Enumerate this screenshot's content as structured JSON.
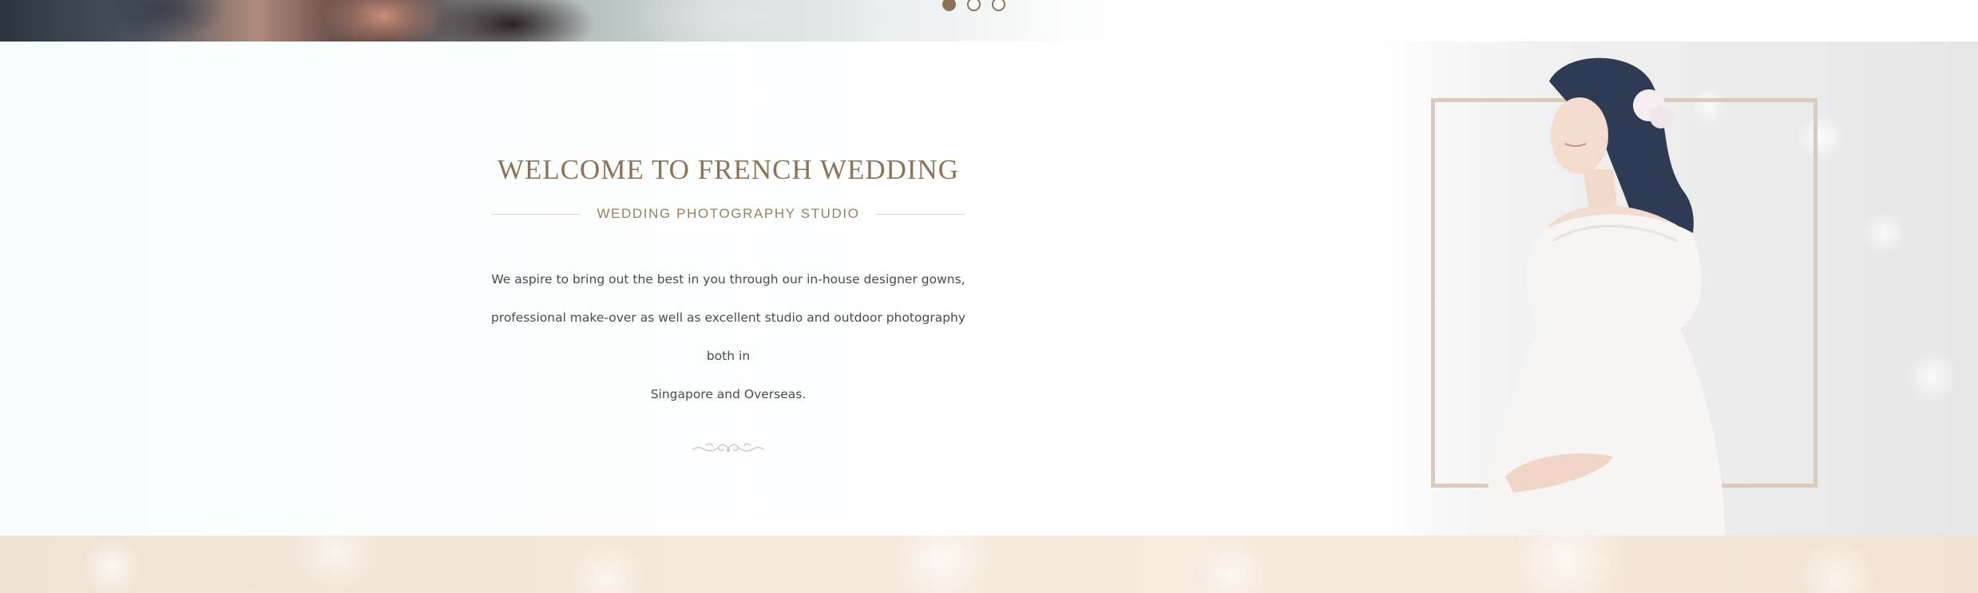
{
  "hero_slider": {
    "slides": [
      {
        "label": "slide-1",
        "active": true
      },
      {
        "label": "slide-2",
        "active": false
      },
      {
        "label": "slide-3",
        "active": false
      }
    ]
  },
  "welcome": {
    "title": "WELCOME TO FRENCH WEDDING",
    "subtitle": "WEDDING PHOTOGRAPHY STUDIO",
    "body_lines": [
      "We aspire to bring out the best in you through our in-house designer gowns,",
      "professional make-over as well as excellent studio and outdoor photography both in",
      "Singapore and Overseas."
    ],
    "ornament_icon": "flourish-divider-icon"
  },
  "colors": {
    "accent_brown": "#8c7357",
    "subtitle_brown": "#9a7f5f",
    "body_text": "#4b4b4b",
    "frame_beige": "#d9cbbd",
    "band_peach": "#f3e7d8"
  }
}
